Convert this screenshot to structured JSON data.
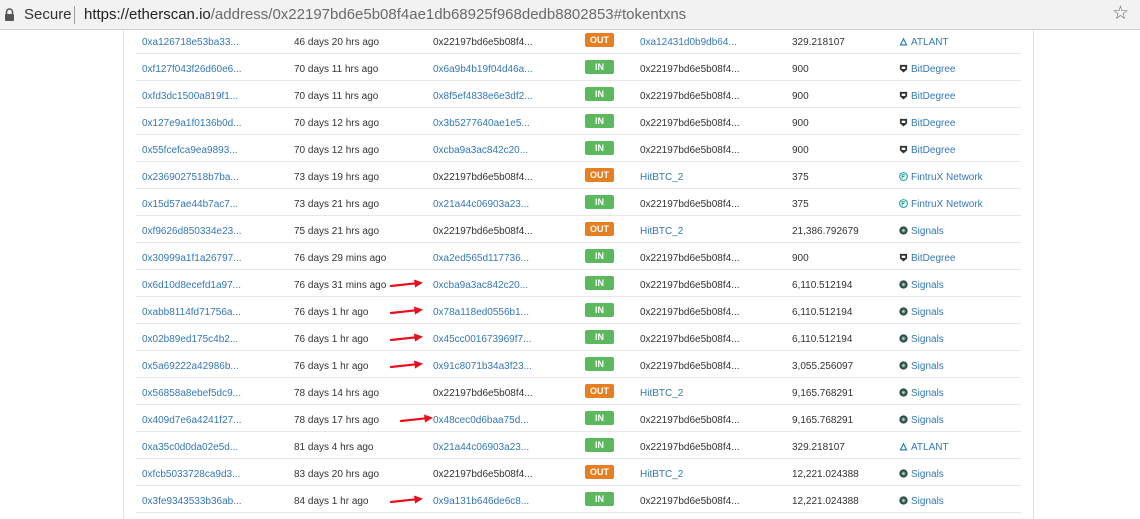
{
  "browser": {
    "security_label": "Secure",
    "url_domain": "https://etherscan.io",
    "url_path": "/address/0x22197bd6e5b08f4ae1db68925f968dedb8802853#tokentxns"
  },
  "colors": {
    "in_badge": "#5cb85c",
    "out_badge": "#e67e22",
    "link": "#3478b6",
    "arrow": "#e8101c"
  },
  "rows": [
    {
      "tx": "0xa126718e53ba33...",
      "age": "46 days 20 hrs ago",
      "from": "0x22197bd6e5b08f4...",
      "from_link": false,
      "dir": "OUT",
      "to": "0xa12431d0b9db64...",
      "to_link": true,
      "value": "329.218107",
      "token": "ATLANT",
      "icon": "atlant-icon",
      "arrow": false
    },
    {
      "tx": "0xf127f043f26d60e6...",
      "age": "70 days 11 hrs ago",
      "from": "0x6a9b4b19f04d46a...",
      "from_link": true,
      "dir": "IN",
      "to": "0x22197bd6e5b08f4...",
      "to_link": false,
      "value": "900",
      "token": "BitDegree",
      "icon": "bitdegree-icon",
      "arrow": false
    },
    {
      "tx": "0xfd3dc1500a819f1...",
      "age": "70 days 11 hrs ago",
      "from": "0x8f5ef4838e6e3df2...",
      "from_link": true,
      "dir": "IN",
      "to": "0x22197bd6e5b08f4...",
      "to_link": false,
      "value": "900",
      "token": "BitDegree",
      "icon": "bitdegree-icon",
      "arrow": false
    },
    {
      "tx": "0x127e9a1f0136b0d...",
      "age": "70 days 12 hrs ago",
      "from": "0x3b5277640ae1e5...",
      "from_link": true,
      "dir": "IN",
      "to": "0x22197bd6e5b08f4...",
      "to_link": false,
      "value": "900",
      "token": "BitDegree",
      "icon": "bitdegree-icon",
      "arrow": false
    },
    {
      "tx": "0x55fcefca9ea9893...",
      "age": "70 days 12 hrs ago",
      "from": "0xcba9a3ac842c20...",
      "from_link": true,
      "dir": "IN",
      "to": "0x22197bd6e5b08f4...",
      "to_link": false,
      "value": "900",
      "token": "BitDegree",
      "icon": "bitdegree-icon",
      "arrow": false
    },
    {
      "tx": "0x2369027518b7ba...",
      "age": "73 days 19 hrs ago",
      "from": "0x22197bd6e5b08f4...",
      "from_link": false,
      "dir": "OUT",
      "to": "HitBTC_2",
      "to_link": true,
      "value": "375",
      "token": "FintruX Network",
      "icon": "fintrux-icon",
      "arrow": false
    },
    {
      "tx": "0x15d57ae44b7ac7...",
      "age": "73 days 21 hrs ago",
      "from": "0x21a44c06903a23...",
      "from_link": true,
      "dir": "IN",
      "to": "0x22197bd6e5b08f4...",
      "to_link": false,
      "value": "375",
      "token": "FintruX Network",
      "icon": "fintrux-icon",
      "arrow": false
    },
    {
      "tx": "0xf9626d850334e23...",
      "age": "75 days 21 hrs ago",
      "from": "0x22197bd6e5b08f4...",
      "from_link": false,
      "dir": "OUT",
      "to": "HitBTC_2",
      "to_link": true,
      "value": "21,386.792679",
      "token": "Signals",
      "icon": "signals-icon",
      "arrow": false
    },
    {
      "tx": "0x30999a1f1a26797...",
      "age": "76 days 29 mins ago",
      "from": "0xa2ed565d117736...",
      "from_link": true,
      "dir": "IN",
      "to": "0x22197bd6e5b08f4...",
      "to_link": false,
      "value": "900",
      "token": "BitDegree",
      "icon": "bitdegree-icon",
      "arrow": false
    },
    {
      "tx": "0x6d10d8ecefd1a97...",
      "age": "76 days 31 mins ago",
      "from": "0xcba9a3ac842c20...",
      "from_link": true,
      "dir": "IN",
      "to": "0x22197bd6e5b08f4...",
      "to_link": false,
      "value": "6,110.512194",
      "token": "Signals",
      "icon": "signals-icon",
      "arrow": true
    },
    {
      "tx": "0xabb8114fd71756a...",
      "age": "76 days 1 hr ago",
      "from": "0x78a118ed0556b1...",
      "from_link": true,
      "dir": "IN",
      "to": "0x22197bd6e5b08f4...",
      "to_link": false,
      "value": "6,110.512194",
      "token": "Signals",
      "icon": "signals-icon",
      "arrow": true
    },
    {
      "tx": "0x02b89ed175c4b2...",
      "age": "76 days 1 hr ago",
      "from": "0x45cc001673969f7...",
      "from_link": true,
      "dir": "IN",
      "to": "0x22197bd6e5b08f4...",
      "to_link": false,
      "value": "6,110.512194",
      "token": "Signals",
      "icon": "signals-icon",
      "arrow": true
    },
    {
      "tx": "0x5a69222a42986b...",
      "age": "76 days 1 hr ago",
      "from": "0x91c8071b34a3f23...",
      "from_link": true,
      "dir": "IN",
      "to": "0x22197bd6e5b08f4...",
      "to_link": false,
      "value": "3,055.256097",
      "token": "Signals",
      "icon": "signals-icon",
      "arrow": true
    },
    {
      "tx": "0x56858a8ebef5dc9...",
      "age": "78 days 14 hrs ago",
      "from": "0x22197bd6e5b08f4...",
      "from_link": false,
      "dir": "OUT",
      "to": "HitBTC_2",
      "to_link": true,
      "value": "9,165.768291",
      "token": "Signals",
      "icon": "signals-icon",
      "arrow": false
    },
    {
      "tx": "0x409d7e6a4241f27...",
      "age": "78 days 17 hrs ago",
      "from": "0x48cec0d6baa75d...",
      "from_link": true,
      "dir": "IN",
      "to": "0x22197bd6e5b08f4...",
      "to_link": false,
      "value": "9,165.768291",
      "token": "Signals",
      "icon": "signals-icon",
      "arrow": true
    },
    {
      "tx": "0xa35c0d0da02e5d...",
      "age": "81 days 4 hrs ago",
      "from": "0x21a44c06903a23...",
      "from_link": true,
      "dir": "IN",
      "to": "0x22197bd6e5b08f4...",
      "to_link": false,
      "value": "329.218107",
      "token": "ATLANT",
      "icon": "atlant-icon",
      "arrow": false
    },
    {
      "tx": "0xfcb5033728ca9d3...",
      "age": "83 days 20 hrs ago",
      "from": "0x22197bd6e5b08f4...",
      "from_link": false,
      "dir": "OUT",
      "to": "HitBTC_2",
      "to_link": true,
      "value": "12,221.024388",
      "token": "Signals",
      "icon": "signals-icon",
      "arrow": false
    },
    {
      "tx": "0x3fe9343533b36ab...",
      "age": "84 days 1 hr ago",
      "from": "0x9a131b646de6c8...",
      "from_link": true,
      "dir": "IN",
      "to": "0x22197bd6e5b08f4...",
      "to_link": false,
      "value": "12,221.024388",
      "token": "Signals",
      "icon": "signals-icon",
      "arrow": true
    }
  ]
}
